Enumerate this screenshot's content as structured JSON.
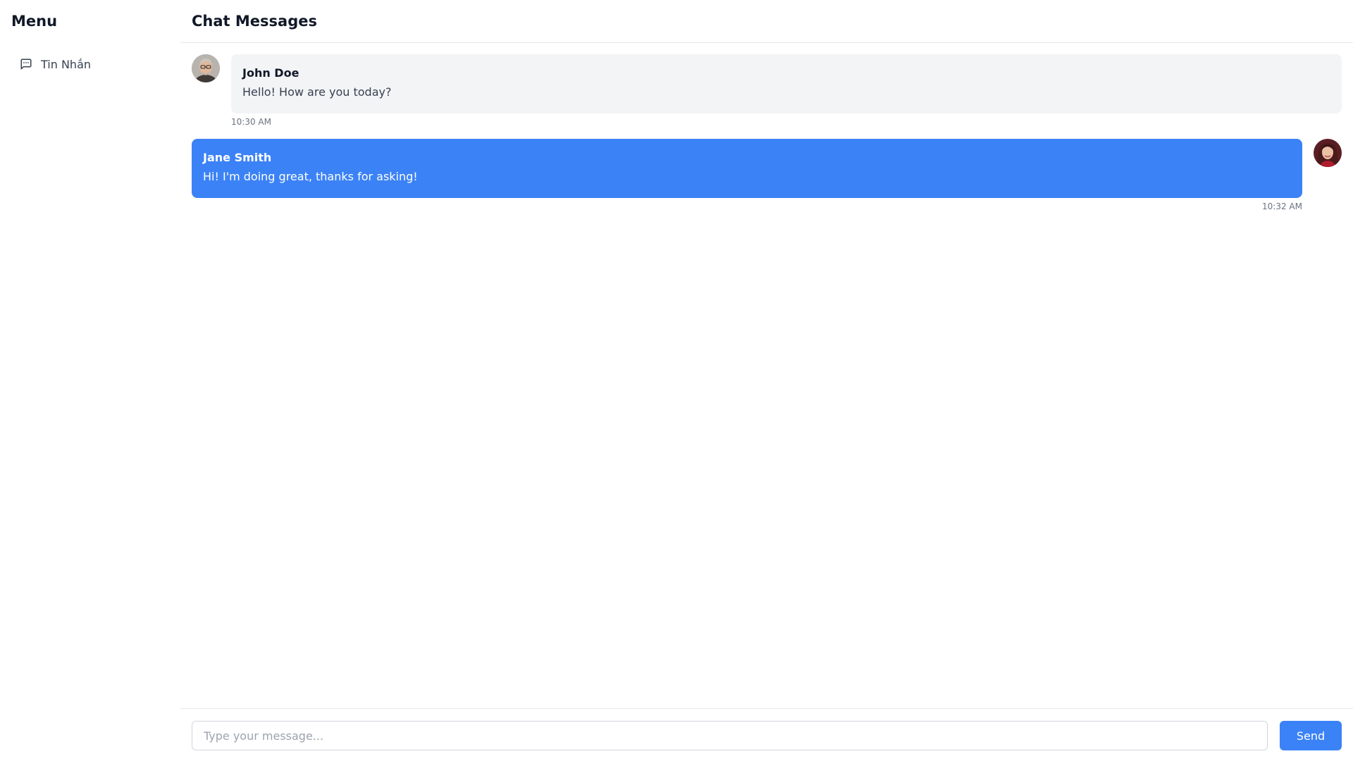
{
  "sidebar": {
    "title": "Menu",
    "items": [
      {
        "label": "Tin Nhắn",
        "icon": "message-square-icon"
      }
    ]
  },
  "header": {
    "title": "Chat Messages"
  },
  "messages": [
    {
      "sender": "John Doe",
      "text": "Hello! How are you today?",
      "time": "10:30 AM",
      "direction": "incoming",
      "avatar": "avatar-john-doe"
    },
    {
      "sender": "Jane Smith",
      "text": "Hi! I'm doing great, thanks for asking!",
      "time": "10:32 AM",
      "direction": "outgoing",
      "avatar": "avatar-jane-smith"
    }
  ],
  "composer": {
    "placeholder": "Type your message...",
    "value": "",
    "send_label": "Send"
  },
  "colors": {
    "accent": "#3b82f6",
    "incoming_bubble": "#f3f4f6",
    "border": "#e5e7eb"
  }
}
